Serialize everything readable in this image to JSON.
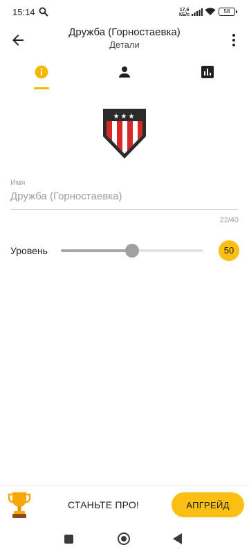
{
  "status_bar": {
    "time": "15:14",
    "net_speed_value": "17,6",
    "net_speed_unit": "КБ/с",
    "battery": "58"
  },
  "header": {
    "title": "Дружба (Горностаевка)",
    "subtitle": "Детали"
  },
  "tabs": [
    {
      "icon": "info-icon",
      "selected": true
    },
    {
      "icon": "person-icon",
      "selected": false
    },
    {
      "icon": "bar-chart-icon",
      "selected": false
    }
  ],
  "form": {
    "name_label": "Имя",
    "name_value": "Дружба (Горностаевка)",
    "name_counter": "22/40",
    "level_label": "Уровень",
    "level_value": "50",
    "level_min": 0,
    "level_max": 100
  },
  "promo": {
    "text": "СТАНЬТЕ ПРО!",
    "button": "АПГРЕЙД"
  },
  "colors": {
    "accent": "#fbbf12",
    "shield_red": "#d62a2a",
    "shield_dark": "#2b2b2b"
  }
}
